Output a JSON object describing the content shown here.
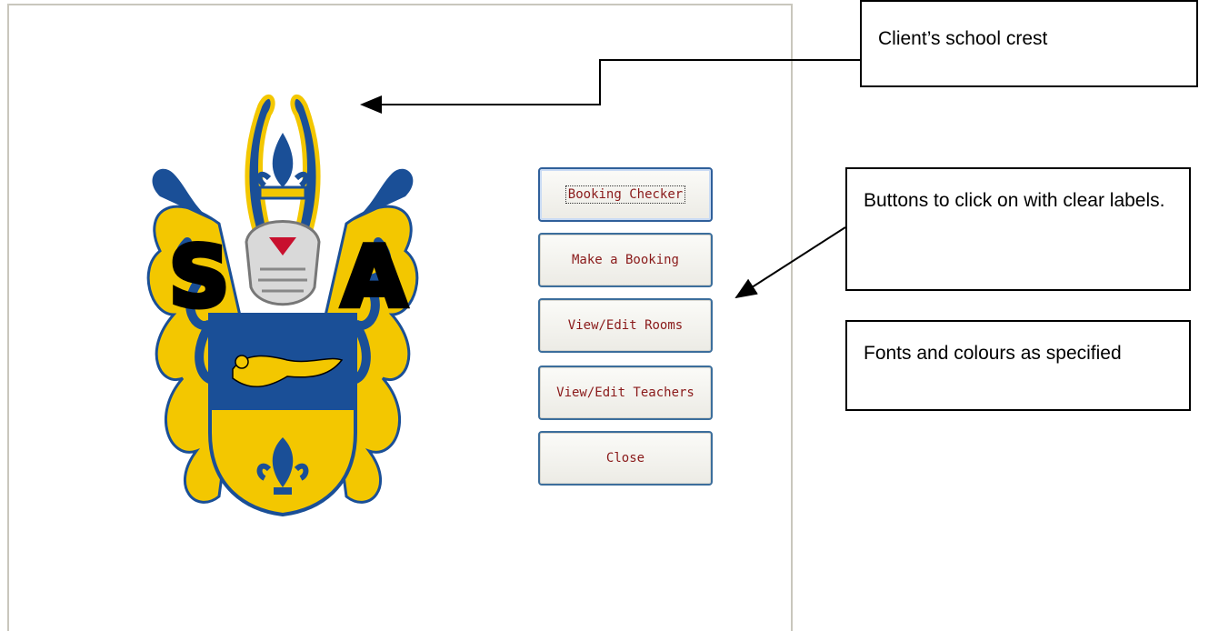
{
  "menu": {
    "buttons": [
      {
        "label": "Booking Checker",
        "focused": true
      },
      {
        "label": "Make a Booking"
      },
      {
        "label": "View/Edit Rooms"
      },
      {
        "label": "View/Edit Teachers"
      },
      {
        "label": "Close"
      }
    ]
  },
  "crest": {
    "letter_left": "S",
    "letter_right": "A",
    "colors": {
      "blue": "#1a4f97",
      "gold": "#f3c700"
    }
  },
  "annotations": {
    "crest_note": "Client’s school crest",
    "buttons_note": "Buttons to click on with clear labels.",
    "fonts_note": "Fonts and colours as specified"
  }
}
